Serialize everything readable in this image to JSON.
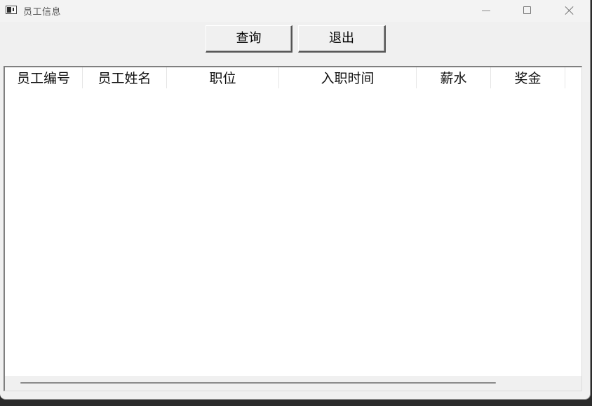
{
  "window": {
    "title": "员工信息",
    "app_icon": "window-app-icon",
    "controls": {
      "minimize": "minimize-icon",
      "maximize": "maximize-icon",
      "close": "close-icon"
    }
  },
  "toolbar": {
    "query_label": "查询",
    "exit_label": "退出"
  },
  "table": {
    "columns": [
      "员工编号",
      "员工姓名",
      "职位",
      "入职时间",
      "薪水",
      "奖金"
    ],
    "rows": []
  },
  "colors": {
    "window_bg": "#f0f0f0",
    "table_bg": "#ffffff",
    "header_text": "#111111"
  }
}
